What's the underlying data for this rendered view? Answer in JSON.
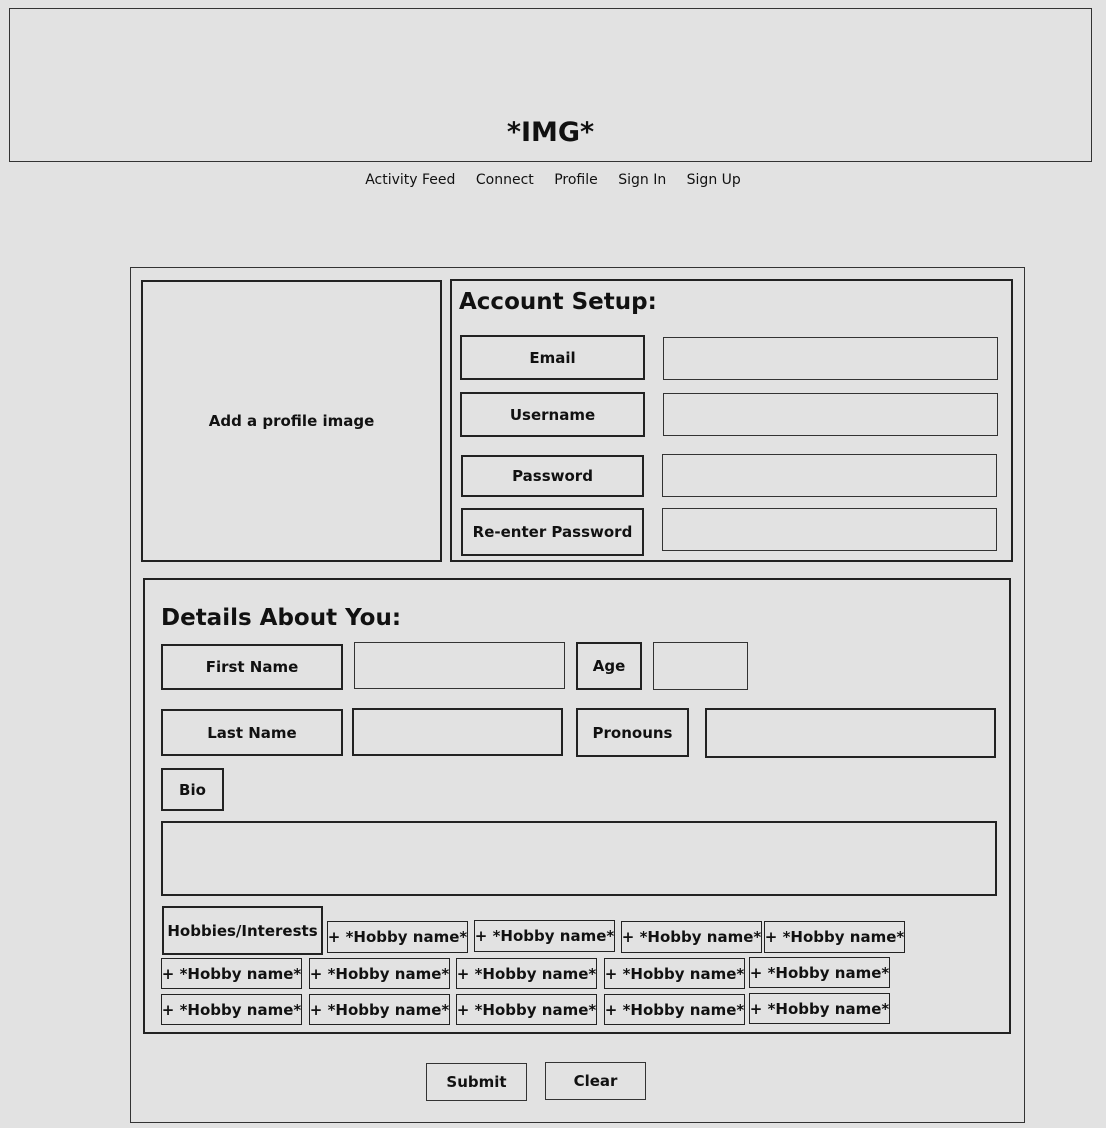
{
  "header": {
    "image_placeholder": "*IMG*"
  },
  "nav": [
    "Activity Feed",
    "Connect",
    "Profile",
    "Sign In",
    "Sign Up"
  ],
  "profile_image": {
    "label": "Add a profile image"
  },
  "account": {
    "title": "Account Setup:",
    "email_label": "Email",
    "username_label": "Username",
    "password_label": "Password",
    "reenter_label": "Re-enter Password"
  },
  "details": {
    "title": "Details About You:",
    "first_name_label": "First Name",
    "last_name_label": "Last Name",
    "age_label": "Age",
    "pronouns_label": "Pronouns",
    "bio_label": "Bio",
    "hobbies_label": "Hobbies/Interests",
    "hobbies": [
      "+ *Hobby name*",
      "+ *Hobby name*",
      "+ *Hobby name*",
      "+ *Hobby name*",
      "+ *Hobby name*",
      "+ *Hobby name*",
      "+ *Hobby name*",
      "+ *Hobby name*",
      "+ *Hobby name*",
      "+ *Hobby name*",
      "+ *Hobby name*",
      "+ *Hobby name*",
      "+ *Hobby name*",
      "+ *Hobby name*"
    ]
  },
  "actions": {
    "submit_label": "Submit",
    "clear_label": "Clear"
  }
}
